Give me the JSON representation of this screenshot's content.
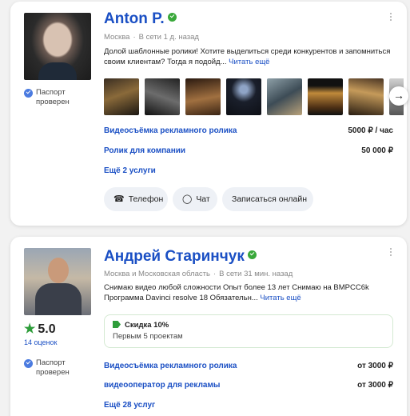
{
  "cards": [
    {
      "name": "Anton P.",
      "location": "Москва",
      "online": "В сети 1 д. назад",
      "description": "Долой шаблонные ролики! Хотите выделиться среди конкурентов и запомниться своим клиентам? Тогда я подойд...",
      "read_more": "Читать ещё",
      "badge": "Паспорт проверен",
      "services": [
        {
          "name": "Видеосъёмка рекламного ролика",
          "price": "5000 ₽ / час"
        },
        {
          "name": "Ролик для компании",
          "price": "50 000 ₽"
        }
      ],
      "more_services": "Ещё 2 услуги",
      "buttons": {
        "phone": "Телефон",
        "chat": "Чат",
        "book": "Записаться онлайн"
      },
      "arrow_icon": "chevron-right-icon"
    },
    {
      "name": "Андрей Старинчук",
      "location": "Москва и Московская область",
      "online": "В сети 31 мин. назад",
      "description": "Снимаю видео любой сложности Опыт более 13 лет Снимаю на BMPCC6k Программа Davinci resolve 18 Обязательн...",
      "read_more": "Читать ещё",
      "rating": "5.0",
      "reviews": "14 оценок",
      "badge": "Паспорт проверен",
      "discount": {
        "title": "Скидка 10%",
        "subtitle": "Первым 5 проектам"
      },
      "services": [
        {
          "name": "Видеосъёмка рекламного ролика",
          "price": "от 3000 ₽"
        },
        {
          "name": "видеооператор для рекламы",
          "price": "от 3000 ₽"
        }
      ],
      "more_services": "Ещё 28 услуг"
    }
  ]
}
